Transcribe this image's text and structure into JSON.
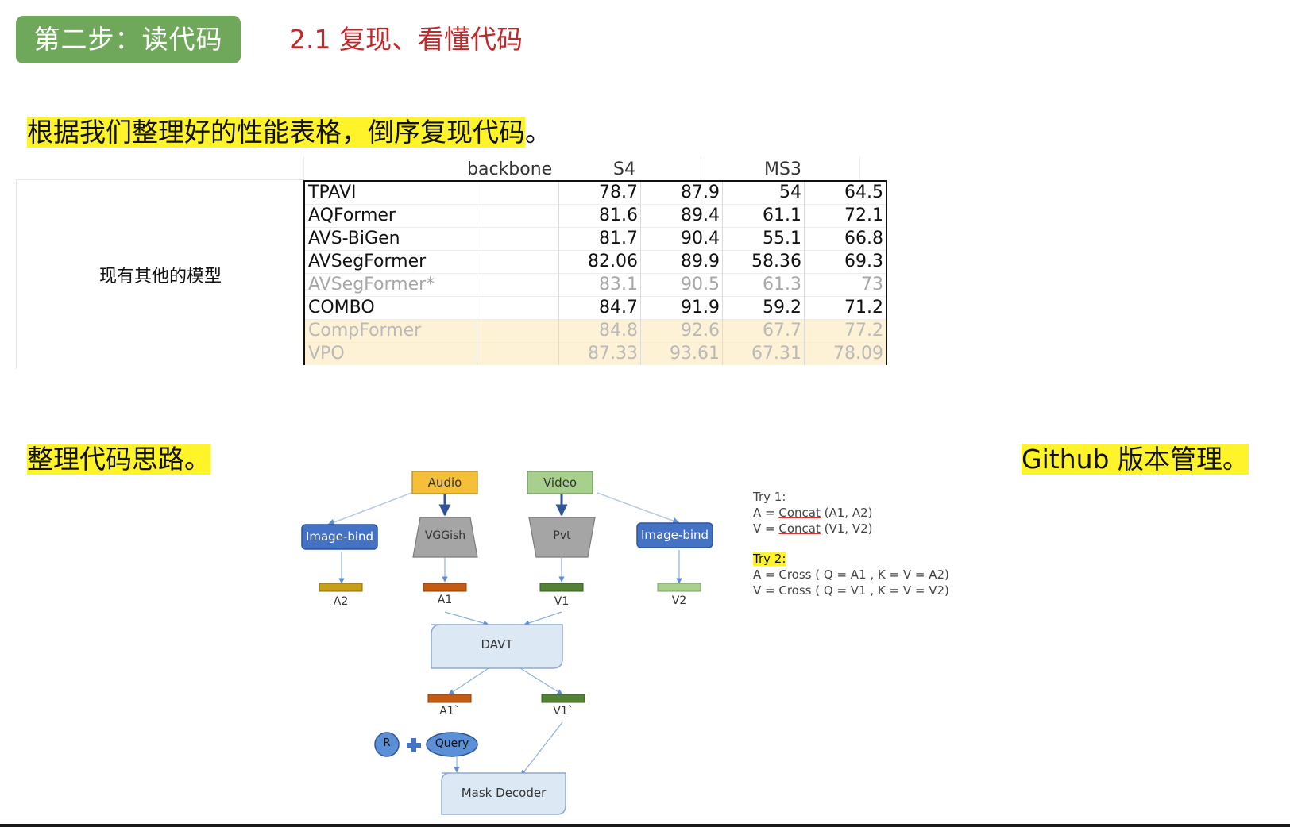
{
  "header": {
    "step_badge": "第二步：读代码",
    "section_title": "2.1 复现、看懂代码"
  },
  "intro_line": "根据我们整理好的性能表格，倒序复现代码",
  "intro_line_suffix": "。",
  "performance_table": {
    "header_backbone": "backbone",
    "header_s4": "S4",
    "header_ms3": "MS3",
    "group_label": "现有其他的模型",
    "rows": [
      {
        "name": "TPAVI",
        "backbone": "",
        "s4_a": "78.7",
        "s4_b": "87.9",
        "ms3_a": "54",
        "ms3_b": "64.5"
      },
      {
        "name": "AQFormer",
        "backbone": "",
        "s4_a": "81.6",
        "s4_b": "89.4",
        "ms3_a": "61.1",
        "ms3_b": "72.1"
      },
      {
        "name": "AVS-BiGen",
        "backbone": "",
        "s4_a": "81.7",
        "s4_b": "90.4",
        "ms3_a": "55.1",
        "ms3_b": "66.8"
      },
      {
        "name": "AVSegFormer",
        "backbone": "",
        "s4_a": "82.06",
        "s4_b": "89.9",
        "ms3_a": "58.36",
        "ms3_b": "69.3"
      },
      {
        "name": "AVSegFormer*",
        "backbone": "",
        "s4_a": "83.1",
        "s4_b": "90.5",
        "ms3_a": "61.3",
        "ms3_b": "73"
      },
      {
        "name": "COMBO",
        "backbone": "",
        "s4_a": "84.7",
        "s4_b": "91.9",
        "ms3_a": "59.2",
        "ms3_b": "71.2"
      },
      {
        "name": "CompFormer",
        "backbone": "",
        "s4_a": "84.8",
        "s4_b": "92.6",
        "ms3_a": "67.7",
        "ms3_b": "77.2"
      },
      {
        "name": "VPO",
        "backbone": "",
        "s4_a": "87.33",
        "s4_b": "93.61",
        "ms3_a": "67.31",
        "ms3_b": "78.09"
      }
    ]
  },
  "code_idea_line": "整理代码思路",
  "code_idea_suffix": "。",
  "github_line": "Github 版本管理",
  "github_suffix": "。",
  "diagram": {
    "audio": "Audio",
    "video": "Video",
    "image_bind_left": "Image-bind",
    "vggish": "VGGish",
    "pvt": "Pvt",
    "image_bind_right": "Image-bind",
    "a2": "A2",
    "a1": "A1",
    "v1": "V1",
    "v2": "V2",
    "davt": "DAVT",
    "a1_prime": "A1`",
    "v1_prime": "V1`",
    "r": "R",
    "query": "Query",
    "mask_decoder": "Mask Decoder",
    "colors": {
      "audio": "#f5bf3a",
      "video": "#a8d08d",
      "image_bind": "#4472c4",
      "encoder": "#a5a5a5",
      "davt": "#dde8f5"
    }
  },
  "notes": {
    "try1_title": "Try 1:",
    "try1_a_prefix": "A = ",
    "try1_a_fn": "Concat",
    "try1_a_args": " (A1, A2)",
    "try1_v_prefix": "V = ",
    "try1_v_fn": "Concat",
    "try1_v_args": " (V1, V2)",
    "try2_title": "Try 2:",
    "try2_a": "A = Cross ( Q = A1 , K = V = A2)",
    "try2_v": "V = Cross ( Q = V1 , K = V = V2)"
  }
}
